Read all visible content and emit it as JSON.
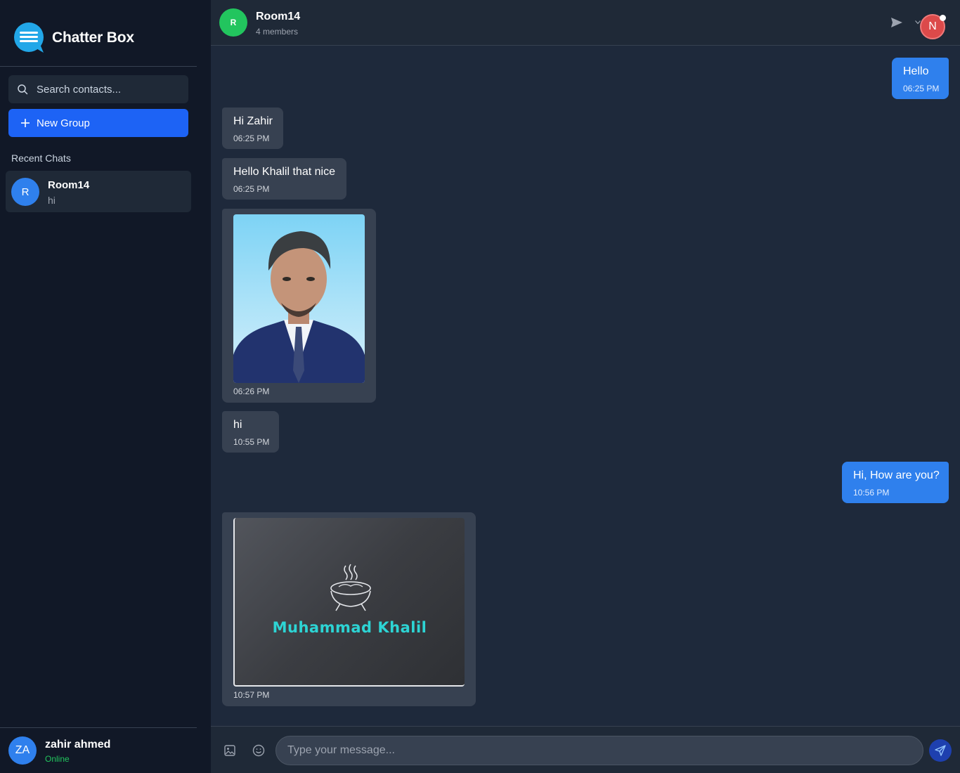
{
  "app": {
    "title": "Chatter Box"
  },
  "sidebar": {
    "search_placeholder": "Search contacts...",
    "new_group_label": "New Group",
    "recent_label": "Recent Chats",
    "chats": [
      {
        "initial": "R",
        "name": "Room14",
        "preview": "hi",
        "avatar_color": "#2f80ed"
      }
    ],
    "current_user": {
      "initials": "ZA",
      "name": "zahir ahmed",
      "status": "Online"
    }
  },
  "header": {
    "room_initial": "R",
    "room_name": "Room14",
    "members": "4 members",
    "user_initial": "N"
  },
  "messages": [
    {
      "direction": "out",
      "text": "Hello",
      "time": "06:25 PM"
    },
    {
      "direction": "in",
      "text": "Hi Zahir",
      "time": "06:25 PM"
    },
    {
      "direction": "in",
      "text": "Hello Khalil that nice",
      "time": "06:25 PM"
    },
    {
      "direction": "in",
      "type": "image",
      "image": "portrait photo",
      "time": "06:26 PM"
    },
    {
      "direction": "in",
      "text": "hi",
      "time": "10:55 PM"
    },
    {
      "direction": "out",
      "text": "Hi, How are you?",
      "time": "10:56 PM"
    },
    {
      "direction": "in",
      "type": "image",
      "image": "logo card",
      "logo_text": "Muhammad Khalil",
      "time": "10:57 PM"
    }
  ],
  "composer": {
    "placeholder": "Type your message..."
  },
  "colors": {
    "accent": "#1d63f5",
    "outgoing_bubble": "#2f80ed",
    "incoming_bubble": "#374151",
    "online": "#22c55e",
    "room_avatar": "#22c55e",
    "user_avatar": "#dc4a4a",
    "logo_text": "#2dd4d4"
  }
}
